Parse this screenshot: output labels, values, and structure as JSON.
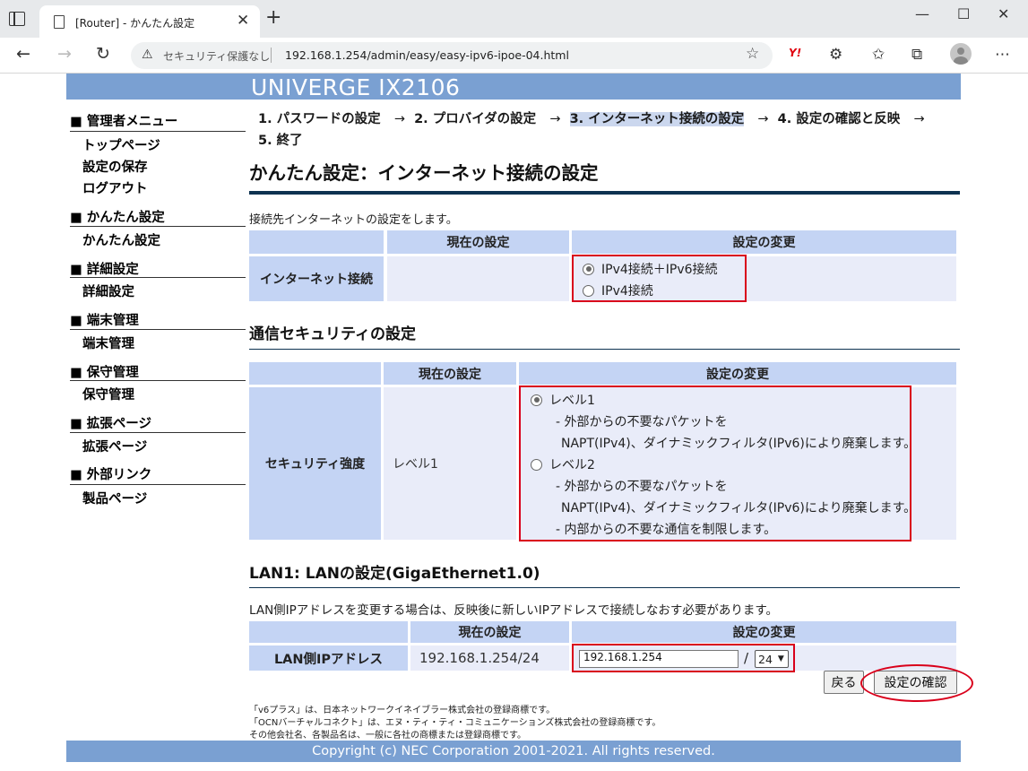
{
  "browser": {
    "tab_title": "[Router] - かんたん設定",
    "tab_close": "✕",
    "new_tab": "+",
    "security_label": "セキュリティ保護なし",
    "url": "192.168.1.254/admin/easy/easy-ipv6-ipoe-04.html",
    "extension_label": "Y!",
    "window_controls": [
      "—",
      "☐",
      "✕"
    ]
  },
  "header": {
    "product": "UNIVERGE IX2106"
  },
  "sidebar": {
    "sections": [
      {
        "heading": "■ 管理者メニュー",
        "items": [
          "トップページ",
          "設定の保存",
          "ログアウト"
        ]
      },
      {
        "heading": "■ かんたん設定",
        "items": [
          "かんたん設定"
        ]
      },
      {
        "heading": "■ 詳細設定",
        "items": [
          "詳細設定"
        ]
      },
      {
        "heading": "■ 端末管理",
        "items": [
          "端末管理"
        ]
      },
      {
        "heading": "■ 保守管理",
        "items": [
          "保守管理"
        ]
      },
      {
        "heading": "■ 拡張ページ",
        "items": [
          "拡張ページ"
        ]
      },
      {
        "heading": "■ 外部リンク",
        "items": [
          "製品ページ"
        ]
      }
    ]
  },
  "steps": {
    "s1": "1. パスワードの設定",
    "s2": "2. プロバイダの設定",
    "s3": "3. インターネット接続の設定",
    "s4": "4. 設定の確認と反映",
    "s5": "5. 終了",
    "arrow": "→"
  },
  "page": {
    "title": "かんたん設定：インターネット接続の設定",
    "description": "接続先インターネットの設定をします。"
  },
  "internet": {
    "col_current": "現在の設定",
    "col_change": "設定の変更",
    "row_label": "インターネット接続",
    "current_value": "",
    "options": [
      "IPv4接続＋IPv6接続",
      "IPv4接続"
    ],
    "selected_index": 0
  },
  "security": {
    "section_title": "通信セキュリティの設定",
    "col_current": "現在の設定",
    "col_change": "設定の変更",
    "row_label": "セキュリティ強度",
    "current_value": "レベル1",
    "level1_label": "レベル1",
    "level1_desc1": "- 外部からの不要なパケットを",
    "level1_desc2": "NAPT(IPv4)、ダイナミックフィルタ(IPv6)により廃棄します。",
    "level2_label": "レベル2",
    "level2_desc1": "- 外部からの不要なパケットを",
    "level2_desc2": "NAPT(IPv4)、ダイナミックフィルタ(IPv6)により廃棄します。",
    "level2_desc3": "- 内部からの不要な通信を制限します。",
    "selected_index": 0
  },
  "lan": {
    "section_title": "LAN1: LANの設定(GigaEthernet1.0)",
    "description": "LAN側IPアドレスを変更する場合は、反映後に新しいIPアドレスで接続しなおす必要があります。",
    "col_current": "現在の設定",
    "col_change": "設定の変更",
    "row_label": "LAN側IPアドレス",
    "current_value": "192.168.1.254/24",
    "ip_value": "192.168.1.254",
    "slash": "/",
    "prefix_value": "24"
  },
  "buttons": {
    "back": "戻る",
    "confirm": "設定の確認"
  },
  "footnotes": [
    "「v6プラス」は、日本ネットワークイネイブラー株式会社の登録商標です。",
    "「OCNバーチャルコネクト」は、エヌ・ティ・ティ・コミュニケーションズ株式会社の登録商標です。",
    "その他会社名、各製品名は、一般に各社の商標または登録商標です。"
  ],
  "footer": {
    "copyright": "Copyright (c) NEC Corporation 2001-2021. All rights reserved."
  },
  "colors": {
    "band": "#7aa0d2",
    "table_header": "#c4d4f4",
    "table_value": "#e9ecf9",
    "highlight": "#d9001b",
    "rule": "#0d3250"
  }
}
